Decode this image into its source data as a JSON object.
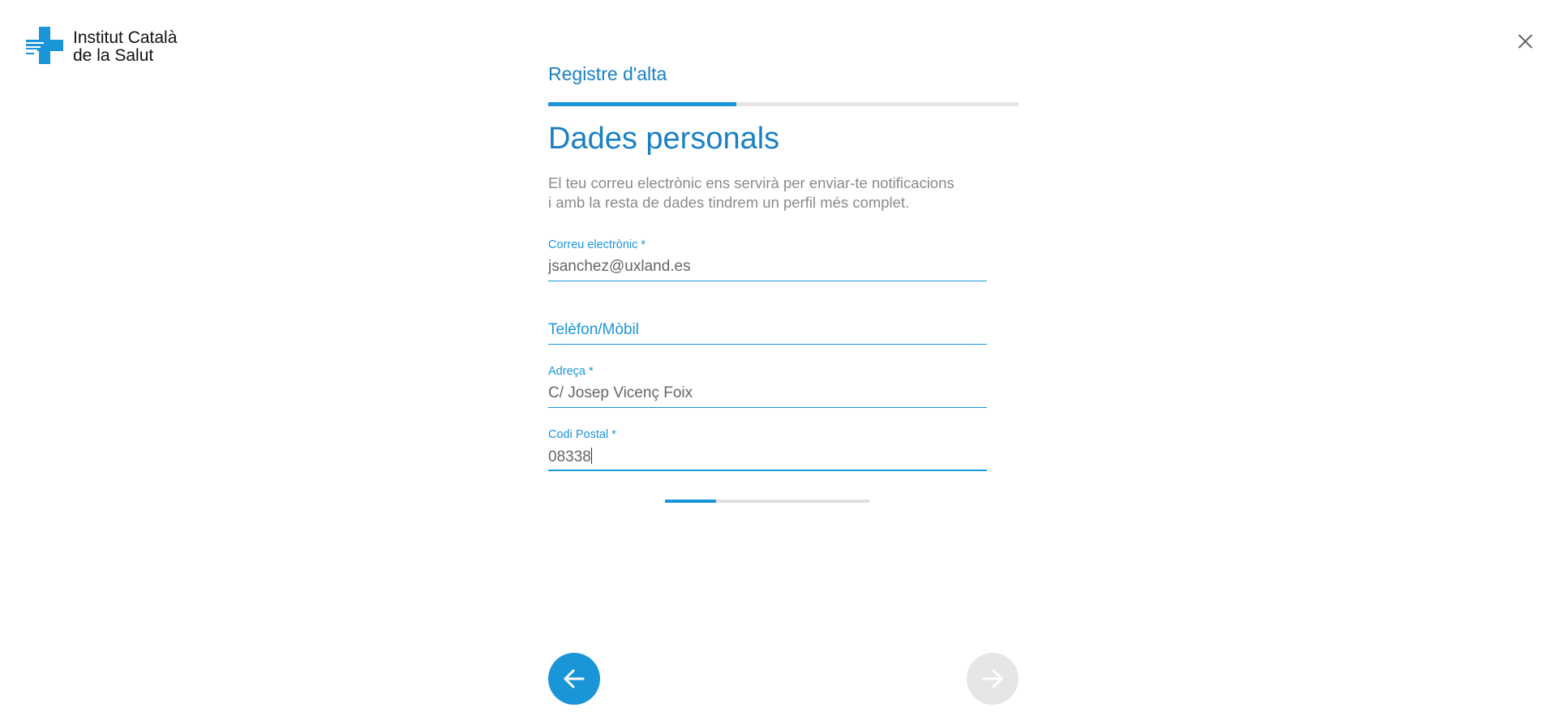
{
  "brand": {
    "line1": "Institut Català",
    "line2": "de la Salut",
    "logo_icon": "ics-cross-logo-icon",
    "accent_color": "#1a95d8"
  },
  "header": {
    "close_icon": "close-icon"
  },
  "wizard": {
    "step_title": "Registre d'alta",
    "step_progress": 0.4
  },
  "section": {
    "title": "Dades personals",
    "description_line1": "El teu correu electrònic ens servirà per enviar-te notificacions",
    "description_line2": "i amb la resta de dades tindrem un perfil més complet."
  },
  "fields": {
    "email": {
      "label": "Correu electrònic *",
      "value": "jsanchez@uxland.es"
    },
    "phone": {
      "label": "Telèfon/Mòbil",
      "value": ""
    },
    "address": {
      "label": "Adreça *",
      "value": "C/ Josep Vicenç Foix"
    },
    "postal_code": {
      "label": "Codi Postal *",
      "value": "08338"
    }
  },
  "form_progress": 0.25,
  "nav": {
    "back_icon": "arrow-left-icon",
    "next_icon": "arrow-right-icon",
    "next_disabled": true
  }
}
